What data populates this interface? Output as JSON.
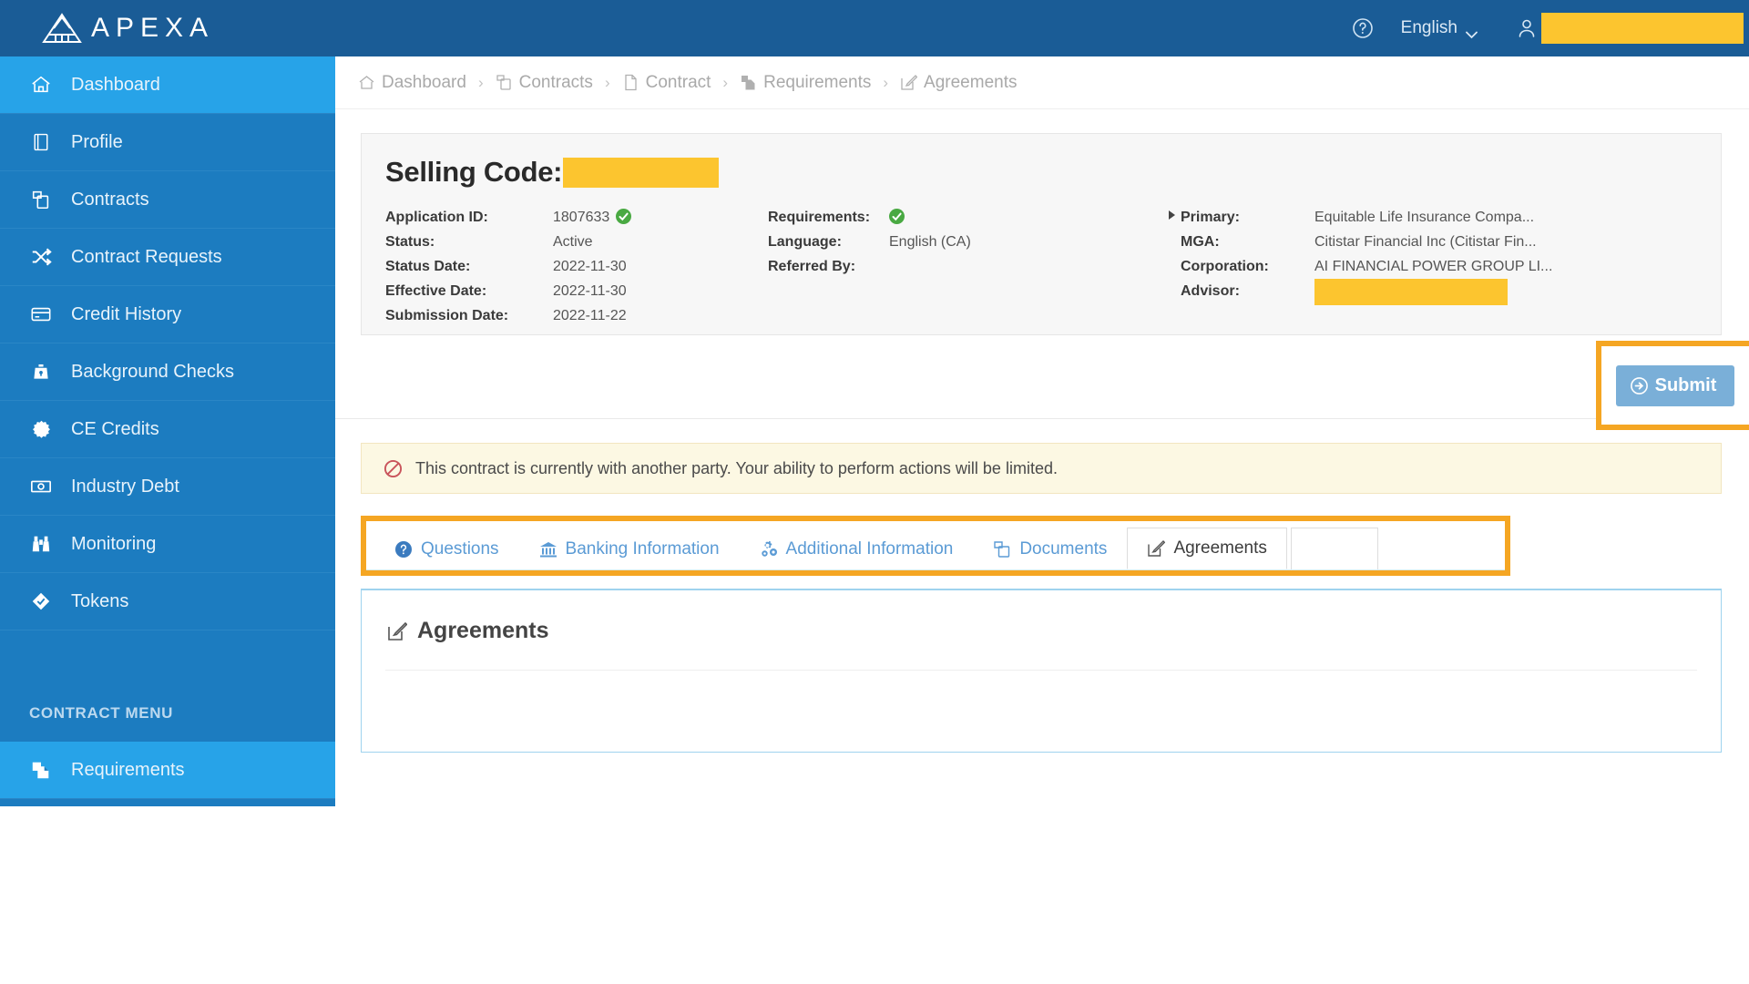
{
  "header": {
    "brand": "APEXA",
    "logo_icon": "apexa-triangle-logo",
    "help_icon": "help-circle-icon",
    "language_label": "English",
    "language_caret_icon": "chevron-down-icon",
    "user_icon": "user-icon",
    "user_name_redacted": "",
    "bg_color": "#1a5c96"
  },
  "sidebar": {
    "bg_color": "#1c7cc0",
    "active_color": "#27a3e8",
    "items": [
      {
        "label": "Dashboard",
        "icon": "home-icon",
        "active": true
      },
      {
        "label": "Profile",
        "icon": "profile-book-icon",
        "active": false
      },
      {
        "label": "Contracts",
        "icon": "contracts-copy-icon",
        "active": false
      },
      {
        "label": "Contract Requests",
        "icon": "shuffle-icon",
        "active": false
      },
      {
        "label": "Credit History",
        "icon": "credit-card-icon",
        "active": false
      },
      {
        "label": "Background Checks",
        "icon": "lock-bag-icon",
        "active": false
      },
      {
        "label": "CE Credits",
        "icon": "certificate-seal-icon",
        "active": false
      },
      {
        "label": "Industry Debt",
        "icon": "money-bill-icon",
        "active": false
      },
      {
        "label": "Monitoring",
        "icon": "binoculars-icon",
        "active": false
      },
      {
        "label": "Tokens",
        "icon": "ticket-icon",
        "active": false
      }
    ],
    "section_title": "CONTRACT MENU",
    "contract_items": [
      {
        "label": "Requirements",
        "icon": "requirements-files-icon",
        "active": true
      }
    ]
  },
  "breadcrumb": [
    {
      "label": "Dashboard",
      "icon": "home-icon"
    },
    {
      "label": "Contracts",
      "icon": "contracts-copy-icon"
    },
    {
      "label": "Contract",
      "icon": "file-icon"
    },
    {
      "label": "Requirements",
      "icon": "requirements-files-icon"
    },
    {
      "label": "Agreements",
      "icon": "edit-square-icon"
    }
  ],
  "breadcrumb_separator": "›",
  "summary": {
    "selling_code_label": "Selling Code:",
    "selling_code_value_redacted": "",
    "col1": {
      "keys": [
        "Application ID:",
        "Status:",
        "Status Date:",
        "Effective Date:",
        "Submission Date:"
      ],
      "values": [
        "1807633",
        "Active",
        "2022-11-30",
        "2022-11-30",
        "2022-11-22"
      ],
      "application_id_status_icon": "green-check-icon"
    },
    "col2": {
      "keys": [
        "Requirements:",
        "Language:",
        "Referred By:"
      ],
      "values": [
        "",
        "English (CA)",
        ""
      ],
      "requirements_status_icon": "green-check-icon"
    },
    "col3": {
      "keys": [
        "Primary:",
        "MGA:",
        "Corporation:",
        "Advisor:"
      ],
      "values": [
        "Equitable Life Insurance Compa...",
        "Citistar Financial Inc (Citistar Fin...",
        "AI FINANCIAL POWER GROUP LI...",
        ""
      ],
      "primary_expand_icon": "caret-right-icon",
      "advisor_value_redacted": ""
    }
  },
  "actions": {
    "submit_label": "Submit",
    "submit_icon": "arrow-right-circle-icon",
    "highlight_color": "#f5a623"
  },
  "alert": {
    "icon": "prohibited-icon",
    "message": "This contract is currently with another party. Your ability to perform actions will be limited.",
    "bg_color": "#fcf8e3"
  },
  "tabs": {
    "items": [
      {
        "label": "Questions",
        "icon": "question-circle-icon",
        "active": false
      },
      {
        "label": "Banking Information",
        "icon": "bank-icon",
        "active": false
      },
      {
        "label": "Additional Information",
        "icon": "gears-icon",
        "active": false
      },
      {
        "label": "Documents",
        "icon": "documents-copy-icon",
        "active": false
      },
      {
        "label": "Agreements",
        "icon": "edit-square-icon",
        "active": true
      }
    ],
    "highlight_color": "#f5a623"
  },
  "panel": {
    "title": "Agreements",
    "icon": "edit-square-icon"
  }
}
